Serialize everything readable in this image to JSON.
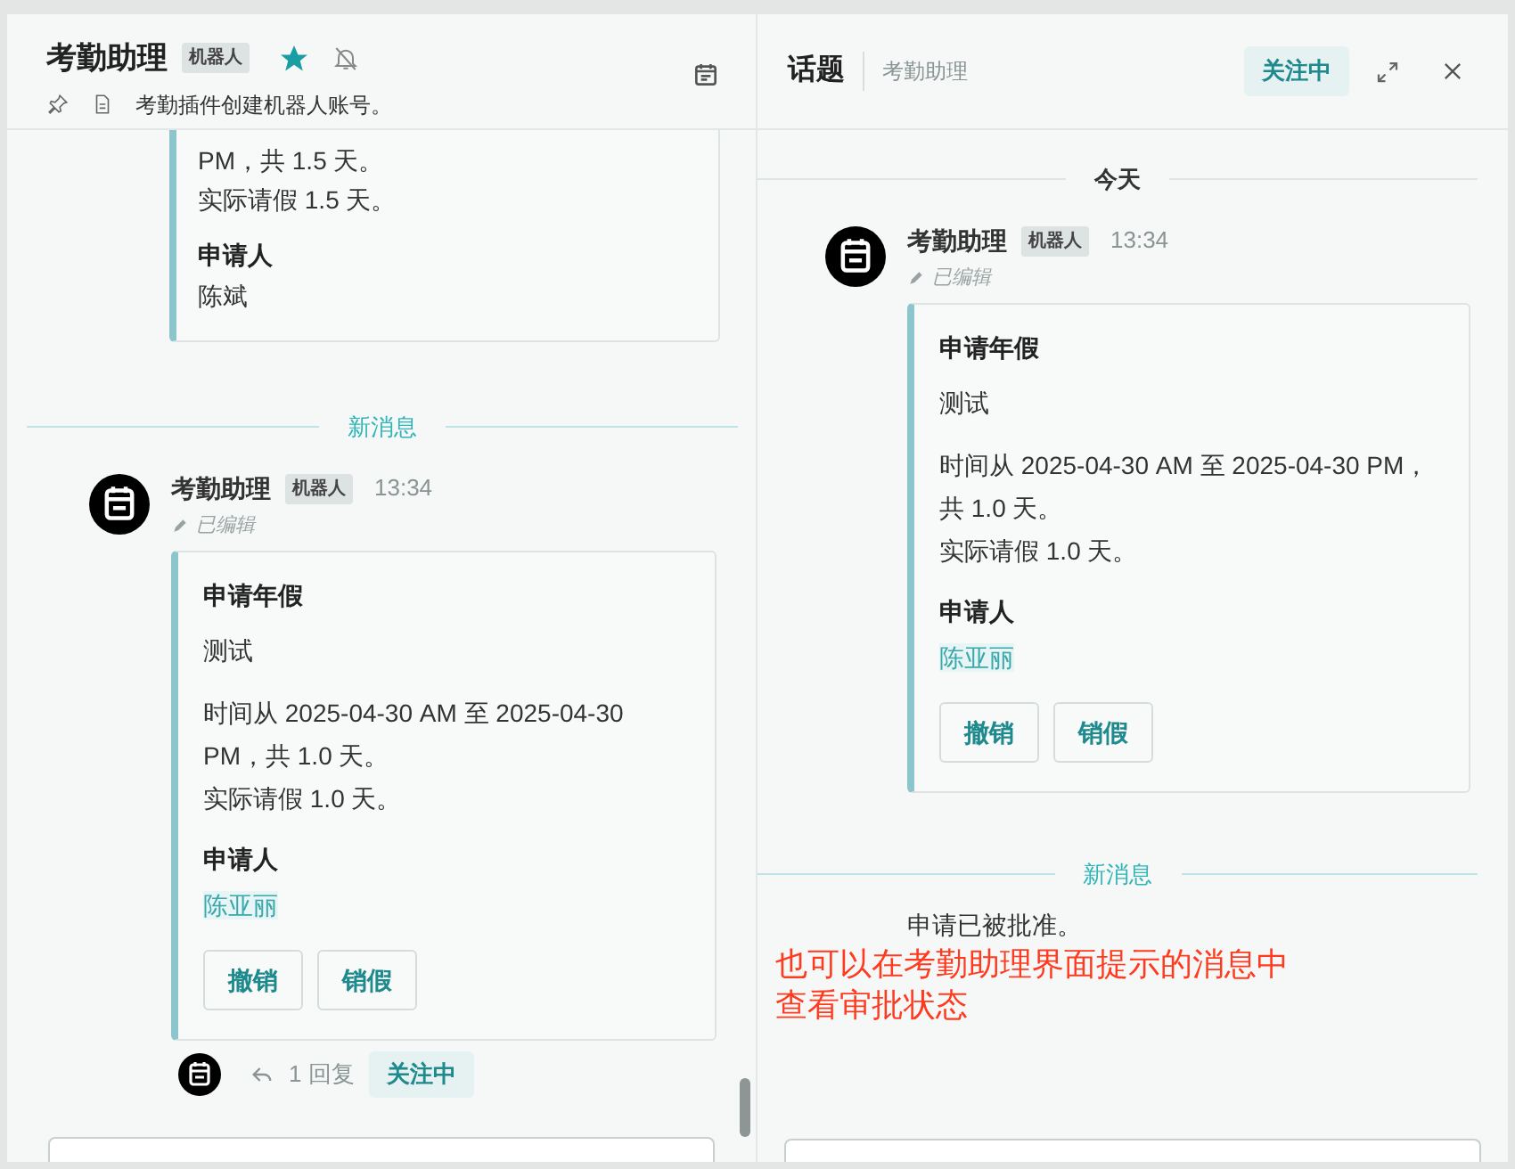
{
  "channel": {
    "title": "考勤助理",
    "badge": "机器人",
    "starred": true,
    "muted": true,
    "description": "考勤插件创建机器人账号。",
    "feed": [
      {
        "kind": "card_tail",
        "lines": [
          "PM，共 1.5 天。",
          "实际请假 1.5 天。"
        ],
        "applicant_label": "申请人",
        "applicant": "陈斌"
      },
      {
        "kind": "divider",
        "label": "新消息"
      },
      {
        "kind": "message",
        "sender": "考勤助理",
        "badge": "机器人",
        "time": "13:34",
        "edited": "已编辑",
        "card": {
          "title": "申请年假",
          "note": "测试",
          "lines": [
            "时间从 2025-04-30 AM 至 2025-04-30 PM，共 1.0 天。",
            "实际请假 1.0 天。"
          ],
          "applicant_label": "申请人",
          "applicant": "陈亚丽",
          "buttons": [
            "撤销",
            "销假"
          ]
        },
        "thread": {
          "replies": "1 回复",
          "follow": "关注中"
        }
      }
    ]
  },
  "thread_panel": {
    "title": "话题",
    "channel": "考勤助理",
    "follow": "关注中",
    "feed": [
      {
        "kind": "divider",
        "label": "今天"
      },
      {
        "kind": "message",
        "sender": "考勤助理",
        "badge": "机器人",
        "time": "13:34",
        "edited": "已编辑",
        "card": {
          "title": "申请年假",
          "note": "测试",
          "lines": [
            "时间从 2025-04-30 AM 至 2025-04-30 PM，共 1.0 天。",
            "实际请假 1.0 天。"
          ],
          "applicant_label": "申请人",
          "applicant": "陈亚丽",
          "buttons": [
            "撤销",
            "销假"
          ]
        }
      },
      {
        "kind": "divider",
        "label": "新消息",
        "accent": true
      },
      {
        "kind": "text",
        "text": "申请已被批准。"
      }
    ]
  },
  "annotation": [
    "也可以在考勤助理界面提示的消息中",
    "查看审批状态"
  ]
}
